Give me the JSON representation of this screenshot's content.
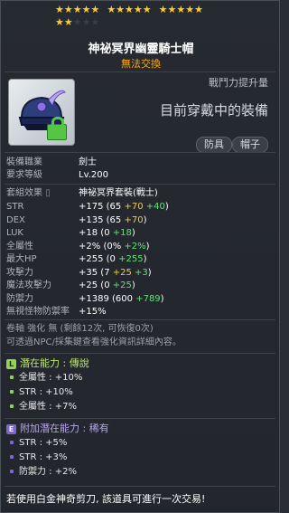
{
  "stars": {
    "row1_filled": 15,
    "row1_total": 15,
    "row2_filled": 2,
    "row2_total": 5
  },
  "item": {
    "name": "神祕冥界幽靈騎士帽",
    "trade": "無法交換"
  },
  "compare": {
    "label": "戰鬥力提升量",
    "text": "目前穿戴中的裝備"
  },
  "tags": [
    "防具",
    "帽子"
  ],
  "requirements": {
    "job_label": "裝備職業",
    "job_value": "劍士",
    "level_label": "要求等級",
    "level_value": "Lv.200"
  },
  "set": {
    "label": "套組效果",
    "value": "神祕冥界套裝(戰士)"
  },
  "stats": [
    {
      "label": "STR",
      "main": "+175",
      "base": "(65",
      "plus1": "+70",
      "plus2": "+40",
      "close": ")"
    },
    {
      "label": "DEX",
      "main": "+135",
      "base": "(65",
      "plus1": "+70",
      "plus2": "",
      "close": ")"
    },
    {
      "label": "LUK",
      "main": "+18",
      "base": "(0",
      "plus1": "",
      "plus2": "+18",
      "close": ")"
    },
    {
      "label": "全屬性",
      "main": "+2%",
      "base": "(0%",
      "plus1": "",
      "plus2": "+2%",
      "close": ")"
    },
    {
      "label": "最大HP",
      "main": "+255",
      "base": "(0",
      "plus1": "",
      "plus2": "+255",
      "close": ")"
    },
    {
      "label": "攻擊力",
      "main": "+35",
      "base": "(7",
      "plus1": "+25",
      "plus2": "+3",
      "close": ")"
    },
    {
      "label": "魔法攻擊力",
      "main": "+25",
      "base": "(0",
      "plus1": "",
      "plus2": "+25",
      "close": ")"
    },
    {
      "label": "防禦力",
      "main": "+1389",
      "base": "(600",
      "plus1": "",
      "plus2": "+789",
      "close": ")"
    },
    {
      "label": "無視怪物防禦率",
      "main": "+15%",
      "base": "",
      "plus1": "",
      "plus2": "",
      "close": ""
    }
  ],
  "upgrade": {
    "line1": "卷軸 強化 無 (剩餘12次, 可恢復0次)",
    "line2": "可透過NPC/採集鍵查看強化資訊詳細內容。"
  },
  "potential": {
    "badge": "L",
    "title": "潛在能力 : 傳說",
    "lines": [
      "全屬性 : +10%",
      "STR : +10%",
      "全屬性 : +7%"
    ]
  },
  "bonus_potential": {
    "badge": "E",
    "title": "附加潛在能力 : 稀有",
    "lines": [
      "STR : +5%",
      "STR : +3%",
      "防禦力 : +2%"
    ]
  },
  "footer": "若使用白金神奇剪刀, 該道具可進行一次交易!",
  "colors": {
    "star": "#ffcc22",
    "legendary": "#8fd64a",
    "rare": "#7d62d8",
    "green_stat": "#66e07a",
    "yellow_stat": "#f0d030"
  }
}
